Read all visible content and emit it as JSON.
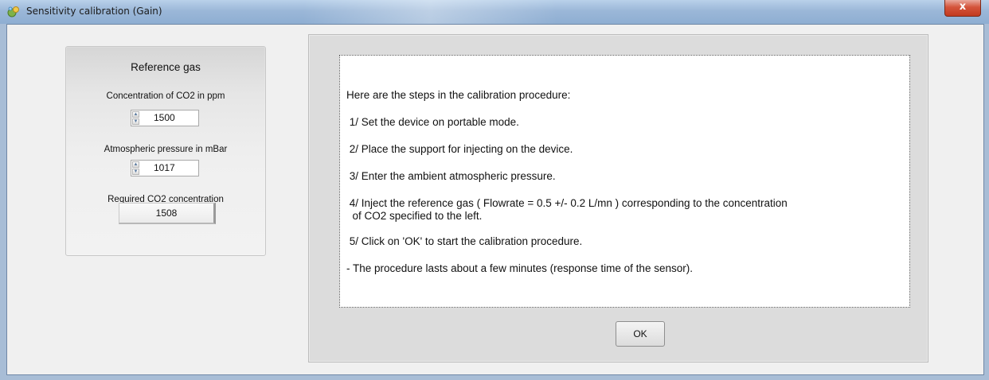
{
  "window": {
    "title": "Sensitivity calibration (Gain)",
    "close_label": "x"
  },
  "reference_gas": {
    "title": "Reference gas",
    "co2_label": "Concentration of CO2 in ppm",
    "co2_value": "1500",
    "pressure_label": "Atmospheric pressure in mBar",
    "pressure_value": "1017",
    "required_label": "Required CO2 concentration",
    "required_value": "1508"
  },
  "instructions": {
    "intro": "Here are the steps in the calibration procedure:",
    "step1": " 1/ Set the device on portable mode.",
    "step2": " 2/ Place the support for injecting on the device.",
    "step3": " 3/ Enter the ambient atmospheric pressure.",
    "step4_line1": " 4/ Inject the reference gas ( Flowrate = 0.5 +/- 0.2 L/mn ) corresponding to the concentration",
    "step4_line2": "  of CO2 specified to the left.",
    "step5": " 5/ Click on 'OK' to start the calibration procedure.",
    "note": "- The procedure lasts about a few minutes (response time of the sensor)."
  },
  "buttons": {
    "ok_label": "OK"
  }
}
